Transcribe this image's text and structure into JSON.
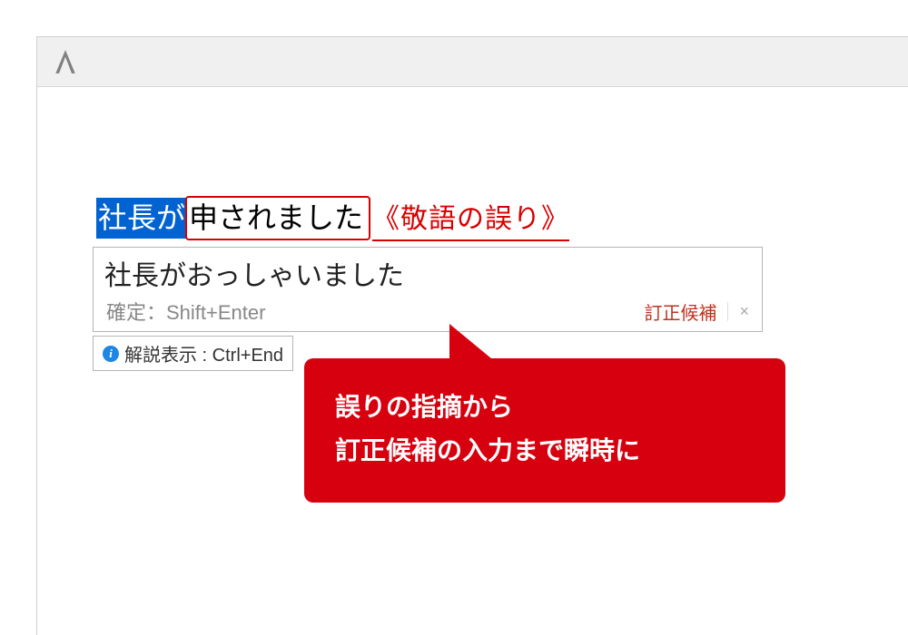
{
  "titlebar": {
    "logo_label": "A"
  },
  "input": {
    "selected": "社長が",
    "error_segment": "申されました",
    "annotation": "《敬語の誤り》"
  },
  "suggestion": {
    "text": "社長がおっしゃいました",
    "confirm_hint": "確定：Shift+Enter",
    "correction_label": "訂正候補",
    "close": "×"
  },
  "hint": {
    "label": "解説表示 : Ctrl+End"
  },
  "callout": {
    "line1": "誤りの指摘から",
    "line2": "訂正候補の入力まで瞬時に"
  }
}
